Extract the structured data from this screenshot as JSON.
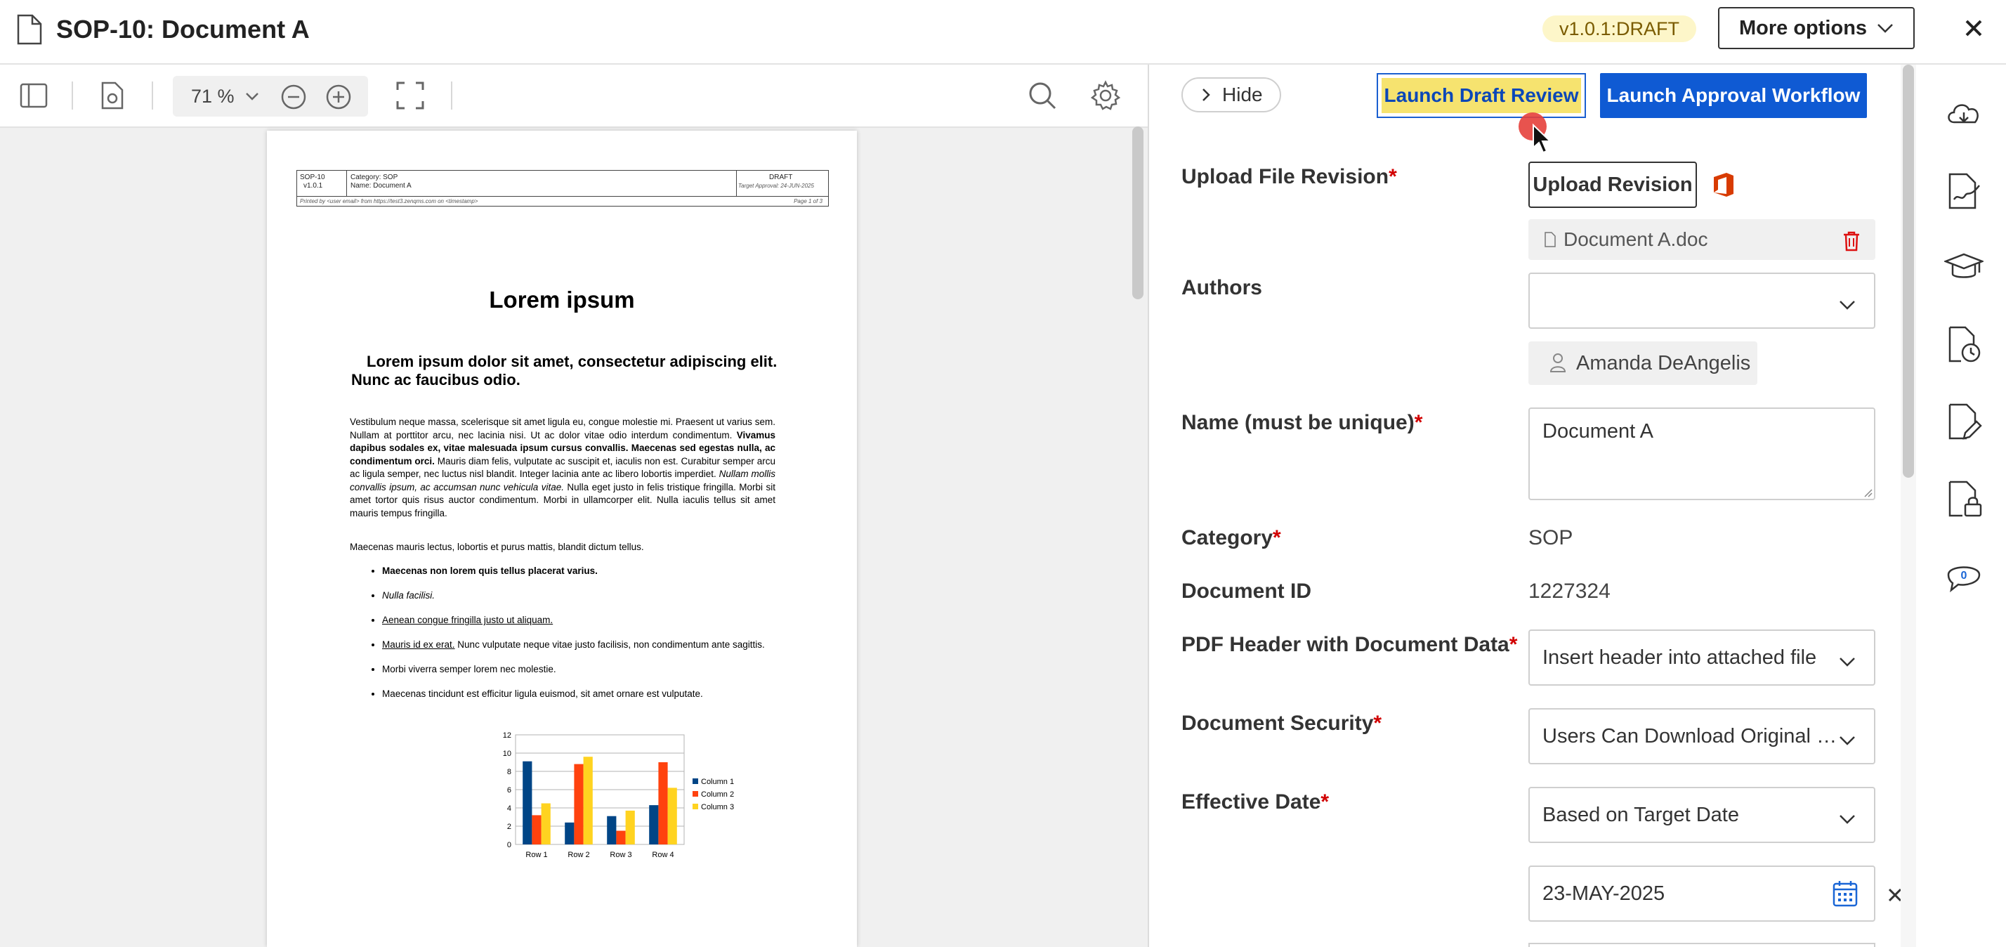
{
  "header": {
    "title": "SOP-10: Document A",
    "version_badge": "v1.0.1:DRAFT",
    "more_options": "More options"
  },
  "viewer": {
    "zoom": "71 %",
    "page": {
      "header_cell_id": "SOP-10",
      "header_cell_ver": "v1.0.1",
      "header_category": "Category: SOP",
      "header_name": "Name: Document A",
      "header_status": "DRAFT",
      "header_target": "Target Approval: 24-JUN-2025",
      "printed_by": "Printed by <user email> from https://test3.zenqms.com on <timestamp>",
      "page_of": "Page 1 of 3",
      "title": "Lorem ipsum",
      "subtitle": "Lorem ipsum dolor sit amet, consectetur adipiscing elit. Nunc ac faucibus odio.",
      "para1_a": "Vestibulum neque massa, scelerisque sit amet ligula eu, congue molestie mi. Praesent ut varius sem. Nullam at porttitor arcu, nec lacinia nisi. Ut ac dolor vitae odio interdum condimentum. ",
      "para1_b": "Vivamus dapibus sodales ex, vitae malesuada ipsum cursus convallis. Maecenas sed egestas nulla, ac condimentum orci.",
      "para1_c": " Mauris diam felis, vulputate ac suscipit et, iaculis non est. Curabitur semper arcu ac ligula semper, nec luctus nisl blandit. Integer lacinia ante ac libero lobortis imperdiet. ",
      "para1_d": "Nullam mollis convallis ipsum, ac accumsan nunc vehicula vitae.",
      "para1_e": " Nulla eget justo in felis tristique fringilla. Morbi sit amet tortor quis risus auctor condimentum. Morbi in ullamcorper elit. Nulla iaculis tellus sit amet mauris tempus fringilla.",
      "para2": "Maecenas mauris lectus, lobortis et purus mattis, blandit dictum tellus.",
      "list1": "Maecenas non lorem quis tellus placerat varius.",
      "list2": "Nulla facilisi.",
      "list3": "Aenean congue fringilla justo ut aliquam.",
      "list4_u": "Mauris id ex erat.",
      "list4_rest": " Nunc vulputate neque vitae justo facilisis, non condimentum ante sagittis.",
      "list5": "Morbi viverra semper lorem nec molestie.",
      "list6": "Maecenas tincidunt est efficitur ligula euismod, sit amet ornare est vulputate."
    }
  },
  "chart_data": {
    "type": "bar",
    "categories": [
      "Row 1",
      "Row 2",
      "Row 3",
      "Row 4"
    ],
    "series": [
      {
        "name": "Column 1",
        "values": [
          9.1,
          2.4,
          3.1,
          4.3
        ],
        "color": "#004586"
      },
      {
        "name": "Column 2",
        "values": [
          3.2,
          8.8,
          1.5,
          9.0
        ],
        "color": "#ff420e"
      },
      {
        "name": "Column 3",
        "values": [
          4.5,
          9.6,
          3.7,
          6.2
        ],
        "color": "#ffd320"
      }
    ],
    "ylim": [
      0,
      12
    ],
    "yticks": [
      "0",
      "2",
      "4",
      "6",
      "8",
      "10",
      "12"
    ],
    "legend": "right"
  },
  "panel": {
    "hide": "Hide",
    "launch_draft_review": "Launch Draft Review",
    "launch_approval": "Launch Approval Workflow",
    "upload_label": "Upload File Revision",
    "upload_button": "Upload Revision",
    "file_name": "Document A.doc",
    "authors_label": "Authors",
    "authors_value": "",
    "author_chip": "Amanda DeAngelis",
    "name_label": "Name (must be unique)",
    "name_value": "Document A",
    "category_label": "Category",
    "category_value": "SOP",
    "docid_label": "Document ID",
    "docid_value": "1227324",
    "pdfheader_label": "PDF Header with Document Data",
    "pdfheader_value": "Insert header into attached file",
    "security_label": "Document Security",
    "security_value": "Users Can Download Original F...",
    "effective_label": "Effective Date",
    "effective_value": "Based on Target Date",
    "date_value": "23-MAY-2025",
    "required_mark": "*"
  },
  "rail": {
    "comments_count": "0"
  },
  "colors": {
    "primary": "#0f5ad3",
    "highlight": "#f6e36f",
    "required": "#d10000",
    "badge_bg": "#fdf6c9"
  }
}
